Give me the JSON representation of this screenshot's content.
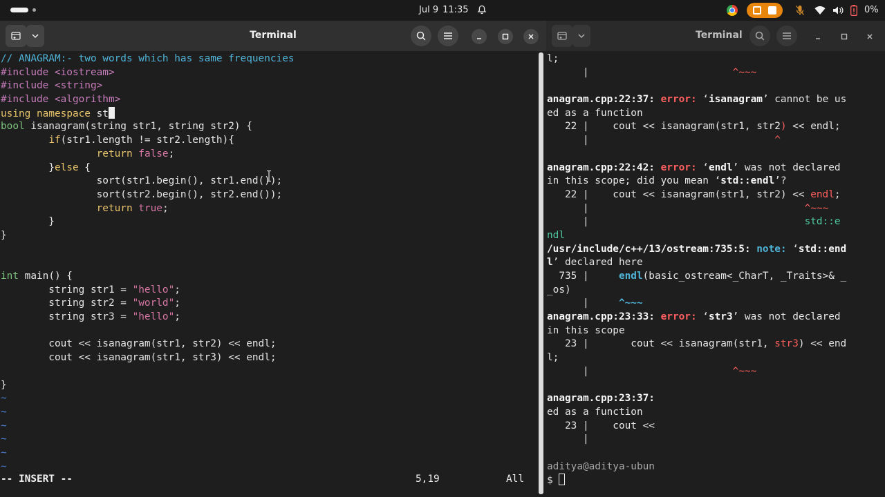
{
  "topbar": {
    "date": "Jul 9",
    "time": "11:35",
    "battery": "0%",
    "icons": [
      "workspace-indicator-icon",
      "bell-icon",
      "chrome-icon",
      "screen-record-icon",
      "mic-off-icon",
      "wifi-icon",
      "volume-icon",
      "battery-icon"
    ]
  },
  "left_window": {
    "title": "Terminal",
    "code_lines": [
      [
        {
          "t": "// ANAGRAM:- two words which has same frequencies",
          "c": "comment"
        }
      ],
      [
        {
          "t": "#include ",
          "c": "pre"
        },
        {
          "t": "<iostream>",
          "c": "pre"
        }
      ],
      [
        {
          "t": "#include ",
          "c": "pre"
        },
        {
          "t": "<string>",
          "c": "pre"
        }
      ],
      [
        {
          "t": "#include ",
          "c": "pre"
        },
        {
          "t": "<algorithm>",
          "c": "pre"
        }
      ],
      [
        {
          "t": "using",
          "c": "keyword"
        },
        {
          "t": " ",
          "c": ""
        },
        {
          "t": "namespace",
          "c": "keyword"
        },
        {
          "t": " st",
          "c": ""
        },
        {
          "t": "",
          "c": "cursor"
        }
      ],
      [
        {
          "t": "bool",
          "c": "type"
        },
        {
          "t": " isanagram(",
          "c": ""
        },
        {
          "t": "string",
          "c": ""
        },
        {
          "t": " str1, ",
          "c": ""
        },
        {
          "t": "string",
          "c": ""
        },
        {
          "t": " str2) {",
          "c": ""
        }
      ],
      [
        {
          "t": "        ",
          "c": ""
        },
        {
          "t": "if",
          "c": "keyword"
        },
        {
          "t": "(str1.length != str2.length){",
          "c": ""
        }
      ],
      [
        {
          "t": "                ",
          "c": ""
        },
        {
          "t": "return",
          "c": "ret"
        },
        {
          "t": " ",
          "c": ""
        },
        {
          "t": "false",
          "c": "string"
        },
        {
          "t": ";",
          "c": ""
        }
      ],
      [
        {
          "t": "        }",
          "c": ""
        },
        {
          "t": "else",
          "c": "keyword"
        },
        {
          "t": " {",
          "c": ""
        }
      ],
      [
        {
          "t": "                sort(str1.begin(), str1.end());",
          "c": ""
        }
      ],
      [
        {
          "t": "                sort(str2.begin(), str2.end());",
          "c": ""
        }
      ],
      [
        {
          "t": "                ",
          "c": ""
        },
        {
          "t": "return",
          "c": "ret"
        },
        {
          "t": " ",
          "c": ""
        },
        {
          "t": "true",
          "c": "string"
        },
        {
          "t": ";",
          "c": ""
        }
      ],
      [
        {
          "t": "        }",
          "c": ""
        }
      ],
      [
        {
          "t": "}",
          "c": ""
        }
      ],
      [
        {
          "t": "",
          "c": ""
        }
      ],
      [
        {
          "t": "",
          "c": ""
        }
      ],
      [
        {
          "t": "int",
          "c": "type"
        },
        {
          "t": " main() {",
          "c": ""
        }
      ],
      [
        {
          "t": "        string str1 = ",
          "c": ""
        },
        {
          "t": "\"hello\"",
          "c": "string"
        },
        {
          "t": ";",
          "c": ""
        }
      ],
      [
        {
          "t": "        string str2 = ",
          "c": ""
        },
        {
          "t": "\"world\"",
          "c": "string"
        },
        {
          "t": ";",
          "c": ""
        }
      ],
      [
        {
          "t": "        string str3 = ",
          "c": ""
        },
        {
          "t": "\"hello\"",
          "c": "string"
        },
        {
          "t": ";",
          "c": ""
        }
      ],
      [
        {
          "t": "",
          "c": ""
        }
      ],
      [
        {
          "t": "        cout << isanagram(str1, str2) << endl;",
          "c": ""
        }
      ],
      [
        {
          "t": "        cout << isanagram(str1, str3) << endl;",
          "c": ""
        }
      ],
      [
        {
          "t": "",
          "c": ""
        }
      ],
      [
        {
          "t": "}",
          "c": ""
        }
      ],
      [
        {
          "t": "~",
          "c": "tilde"
        }
      ],
      [
        {
          "t": "~",
          "c": "tilde"
        }
      ],
      [
        {
          "t": "~",
          "c": "tilde"
        }
      ],
      [
        {
          "t": "~",
          "c": "tilde"
        }
      ],
      [
        {
          "t": "~",
          "c": "tilde"
        }
      ],
      [
        {
          "t": "~",
          "c": "tilde"
        }
      ]
    ],
    "status": {
      "mode": "-- INSERT --",
      "position": "5,19",
      "scroll": "All"
    }
  },
  "right_window": {
    "title": "Terminal",
    "lines": [
      [
        {
          "t": "l;",
          "c": ""
        }
      ],
      [
        {
          "t": "      |                        ",
          "c": ""
        },
        {
          "t": "^~~~",
          "c": "red"
        }
      ],
      [
        {
          "t": "",
          "c": ""
        }
      ],
      [
        {
          "t": "anagram.cpp:22:37: ",
          "c": "b"
        },
        {
          "t": "error: ",
          "c": "err"
        },
        {
          "t": "‘",
          "c": ""
        },
        {
          "t": "isanagram",
          "c": "b"
        },
        {
          "t": "’ cannot be us",
          "c": ""
        }
      ],
      [
        {
          "t": "ed as a function",
          "c": ""
        }
      ],
      [
        {
          "t": "   22 |    cout << isanagram(str1, str2",
          "c": ""
        },
        {
          "t": ")",
          "c": "red"
        },
        {
          "t": " << endl;",
          "c": ""
        }
      ],
      [
        {
          "t": "      |                               ",
          "c": ""
        },
        {
          "t": "^",
          "c": "red"
        }
      ],
      [
        {
          "t": "",
          "c": ""
        }
      ],
      [
        {
          "t": "anagram.cpp:22:42: ",
          "c": "b"
        },
        {
          "t": "error: ",
          "c": "err"
        },
        {
          "t": "‘",
          "c": ""
        },
        {
          "t": "endl",
          "c": "b"
        },
        {
          "t": "’ was not declared",
          "c": ""
        }
      ],
      [
        {
          "t": "in this scope; did you mean ‘",
          "c": ""
        },
        {
          "t": "std::endl",
          "c": "b"
        },
        {
          "t": "’?",
          "c": ""
        }
      ],
      [
        {
          "t": "   22 |    cout << isanagram(str1, str2) << ",
          "c": ""
        },
        {
          "t": "endl",
          "c": "red"
        },
        {
          "t": ";",
          "c": ""
        }
      ],
      [
        {
          "t": "      |                                    ",
          "c": ""
        },
        {
          "t": "^~~~",
          "c": "red"
        }
      ],
      [
        {
          "t": "      |                                    ",
          "c": ""
        },
        {
          "t": "std::e",
          "c": "hint"
        }
      ],
      [
        {
          "t": "ndl",
          "c": "hint"
        }
      ],
      [
        {
          "t": "/usr/include/c++/13/ostream:735:5: ",
          "c": "b"
        },
        {
          "t": "note: ",
          "c": "note"
        },
        {
          "t": "‘",
          "c": ""
        },
        {
          "t": "std::end",
          "c": "b"
        }
      ],
      [
        {
          "t": "l",
          "c": "b"
        },
        {
          "t": "’ declared here",
          "c": ""
        }
      ],
      [
        {
          "t": "  735 |     ",
          "c": ""
        },
        {
          "t": "endl",
          "c": "note"
        },
        {
          "t": "(basic_ostream<_CharT, _Traits>& _",
          "c": ""
        }
      ],
      [
        {
          "t": "_os)",
          "c": ""
        }
      ],
      [
        {
          "t": "      |     ",
          "c": ""
        },
        {
          "t": "^~~~",
          "c": "note"
        }
      ],
      [
        {
          "t": "anagram.cpp:23:33: ",
          "c": "b"
        },
        {
          "t": "error: ",
          "c": "err"
        },
        {
          "t": "‘",
          "c": ""
        },
        {
          "t": "str3",
          "c": "b"
        },
        {
          "t": "’ was not declared",
          "c": ""
        }
      ],
      [
        {
          "t": "in this scope",
          "c": ""
        }
      ],
      [
        {
          "t": "   23 |       cout << isanagram(str1, ",
          "c": ""
        },
        {
          "t": "str3",
          "c": "red"
        },
        {
          "t": ") << end",
          "c": ""
        }
      ],
      [
        {
          "t": "l;",
          "c": ""
        }
      ],
      [
        {
          "t": "      |                        ",
          "c": ""
        },
        {
          "t": "^~~~",
          "c": "red"
        }
      ],
      [
        {
          "t": "",
          "c": ""
        }
      ],
      [
        {
          "t": "anagram.cpp:23:37: ",
          "c": "b"
        }
      ],
      [
        {
          "t": "ed as a function",
          "c": ""
        }
      ],
      [
        {
          "t": "   23 |    cout <<",
          "c": ""
        }
      ],
      [
        {
          "t": "      |",
          "c": ""
        }
      ],
      [
        {
          "t": "",
          "c": ""
        }
      ],
      [
        {
          "t": "aditya@aditya-ubun",
          "c": "prompt"
        }
      ],
      [
        {
          "t": "$ ",
          "c": ""
        },
        {
          "t": "",
          "c": "cursorhollow"
        }
      ]
    ]
  },
  "colors": {
    "accent_orange": "#e8850c",
    "error_red": "#ff5f5f",
    "note_cyan": "#4fb4d8"
  }
}
